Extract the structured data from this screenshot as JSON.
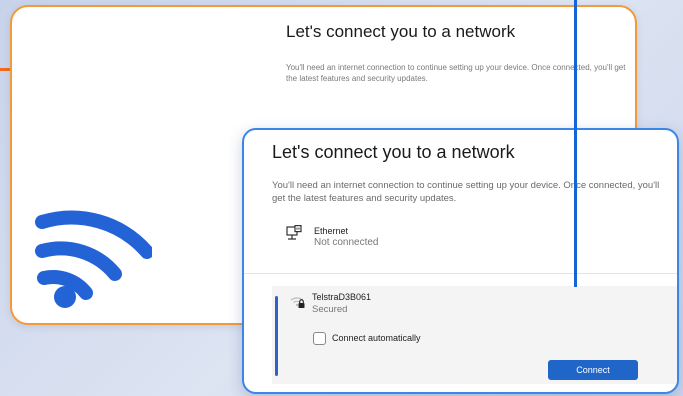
{
  "back_card": {
    "title": "Let's connect you to a network",
    "description": "You'll need an internet connection to continue setting up your device. Once connected, you'll get the latest features and security updates."
  },
  "front_card": {
    "title": "Let's connect you to a network",
    "description": "You'll need an internet connection to continue setting up your device. Once connected, you'll get the latest features and security updates.",
    "ethernet": {
      "name": "Ethernet",
      "status": "Not connected",
      "icon": "ethernet-icon"
    },
    "network": {
      "name": "TelstraD3B061",
      "status": "Secured",
      "icon": "wifi-secured-icon",
      "connect_automatically_label": "Connect automatically",
      "connect_automatically_checked": false,
      "connect_button_label": "Connect"
    }
  },
  "decoration": {
    "wifi_icon": "wifi-icon",
    "colors": {
      "wifi": "#2463d6",
      "back_border": "#f29a3a",
      "front_border": "#3c86e6",
      "connector": "#f26a1b",
      "accent_line": "#1565d8",
      "button": "#2065c8"
    }
  }
}
